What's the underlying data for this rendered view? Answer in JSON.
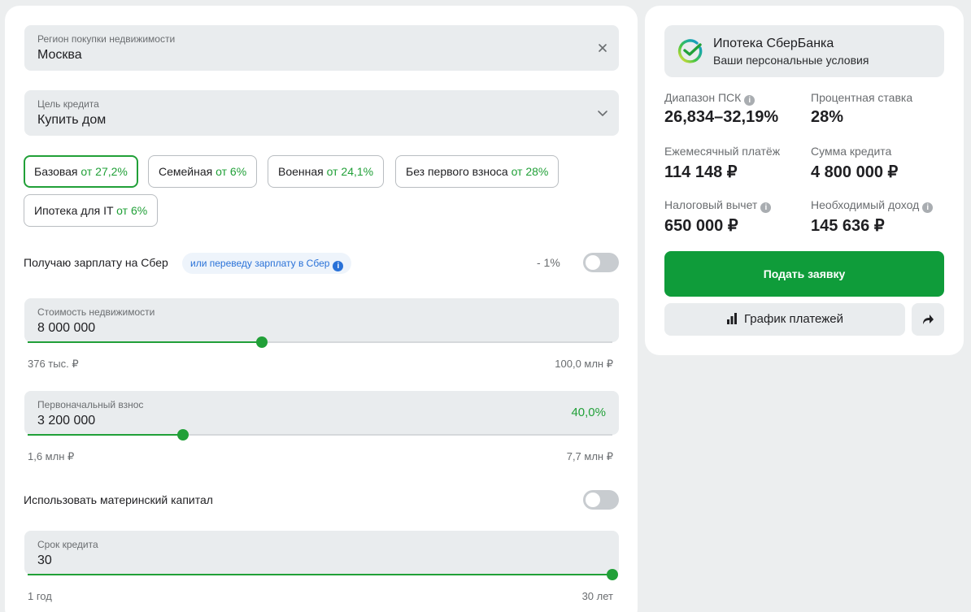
{
  "form": {
    "region": {
      "label": "Регион покупки недвижимости",
      "value": "Москва"
    },
    "purpose": {
      "label": "Цель кредита",
      "value": "Купить дом"
    },
    "programs": [
      {
        "name": "Базовая",
        "rate": "от 27,2%"
      },
      {
        "name": "Семейная",
        "rate": "от 6%"
      },
      {
        "name": "Военная",
        "rate": "от 24,1%"
      },
      {
        "name": "Без первого взноса",
        "rate": "от 28%"
      },
      {
        "name": "Ипотека для IT",
        "rate": "от 6%"
      }
    ],
    "salary": {
      "label": "Получаю зарплату на Сбер",
      "hint": "или переведу зарплату в Сбер",
      "discount": "- 1%",
      "enabled": false
    },
    "price": {
      "label": "Стоимость недвижимости",
      "value": "8 000 000",
      "min_label": "376 тыс. ₽",
      "max_label": "100,0 млн ₽",
      "slider_level": 0.4
    },
    "down_payment": {
      "label": "Первоначальный взнос",
      "value": "3 200 000",
      "percent": "40,0%",
      "min_label": "1,6 млн ₽",
      "max_label": "7,7 млн ₽",
      "slider_level": 0.265
    },
    "maternity": {
      "label": "Использовать материнский капитал",
      "enabled": false
    },
    "term": {
      "label": "Срок кредита",
      "value": "30",
      "min_label": "1 год",
      "max_label": "30 лет",
      "slider_level": 1.0
    }
  },
  "summary": {
    "title": "Ипотека СберБанка",
    "subtitle": "Ваши персональные условия",
    "stats": [
      {
        "label": "Диапазон ПСК",
        "value": "26,834–32,19%"
      },
      {
        "label": "Процентная ставка",
        "value": "28%"
      },
      {
        "label": "Ежемесячный платёж",
        "value": "114 148 ₽"
      },
      {
        "label": "Сумма кредита",
        "value": "4 800 000 ₽"
      },
      {
        "label": "Налоговый вычет",
        "value": "650 000 ₽"
      },
      {
        "label": "Необходимый доход",
        "value": "145 636 ₽"
      }
    ],
    "apply_button": "Подать заявку",
    "schedule_button": "График платежей"
  },
  "colors": {
    "accent": "#21a038",
    "button": "#0f9c3a",
    "info": "#2a72d8"
  },
  "icons": [
    "close-icon",
    "chevron-down-icon",
    "info-icon",
    "sber-logo-icon",
    "bar-chart-icon",
    "share-icon"
  ]
}
